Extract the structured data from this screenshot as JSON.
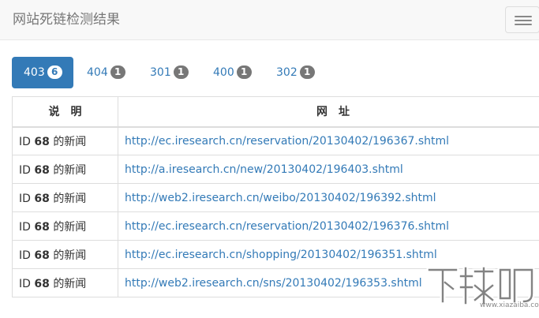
{
  "navbar": {
    "title": "网站死链检测结果",
    "menu_icon": "hamburger-menu-icon"
  },
  "tabs": [
    {
      "label": "403",
      "count": "6",
      "active": true
    },
    {
      "label": "404",
      "count": "1",
      "active": false
    },
    {
      "label": "301",
      "count": "1",
      "active": false
    },
    {
      "label": "400",
      "count": "1",
      "active": false
    },
    {
      "label": "302",
      "count": "1",
      "active": false
    }
  ],
  "table": {
    "headers": [
      "说　明",
      "网　址"
    ],
    "rows": [
      {
        "id_prefix": "ID",
        "id": "68",
        "suffix": "的新闻",
        "url": "http://ec.iresearch.cn/reservation/20130402/196367.shtml"
      },
      {
        "id_prefix": "ID",
        "id": "68",
        "suffix": "的新闻",
        "url": "http://a.iresearch.cn/new/20130402/196403.shtml"
      },
      {
        "id_prefix": "ID",
        "id": "68",
        "suffix": "的新闻",
        "url": "http://web2.iresearch.cn/weibo/20130402/196392.shtml"
      },
      {
        "id_prefix": "ID",
        "id": "68",
        "suffix": "的新闻",
        "url": "http://ec.iresearch.cn/reservation/20130402/196376.shtml"
      },
      {
        "id_prefix": "ID",
        "id": "68",
        "suffix": "的新闻",
        "url": "http://ec.iresearch.cn/shopping/20130402/196351.shtml"
      },
      {
        "id_prefix": "ID",
        "id": "68",
        "suffix": "的新闻",
        "url": "http://web2.iresearch.cn/sns/20130402/196353.shtml"
      }
    ]
  },
  "watermark": {
    "logo_text": "下载吧",
    "site": "www.xiazaiba.com"
  },
  "colors": {
    "accent": "#337ab7",
    "badge": "#777777",
    "navbar_bg": "#f8f8f8",
    "border": "#dddddd"
  }
}
